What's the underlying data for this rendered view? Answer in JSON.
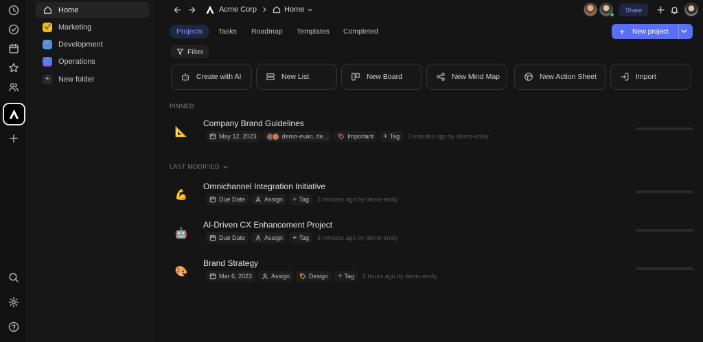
{
  "rail": {
    "icons": [
      "clock-icon",
      "check-circle-icon",
      "calendar-icon",
      "star-icon",
      "users-icon",
      "add-workspace-icon",
      "search-icon",
      "gear-icon",
      "help-icon"
    ]
  },
  "sidebar": {
    "items": [
      {
        "label": "Home"
      },
      {
        "label": "Marketing",
        "badge": "🚀",
        "color": "#f2c200"
      },
      {
        "label": "Development",
        "badge": "👾",
        "color": "#3aa0e8"
      },
      {
        "label": "Operations",
        "badge": "🌐",
        "color": "#7a67f0"
      },
      {
        "label": "New folder"
      }
    ]
  },
  "topbar": {
    "workspace": "Acme Corp",
    "page": "Home",
    "share_label": "Share"
  },
  "tabs": [
    "Projects",
    "Tasks",
    "Roadmap",
    "Templates",
    "Completed"
  ],
  "new_project_label": "New project",
  "filter_label": "Filter",
  "actions": [
    "Create with AI",
    "New List",
    "New Board",
    "New Mind Map",
    "New Action Sheet",
    "Import"
  ],
  "pinned_label": "PINNED",
  "last_modified_label": "LAST MODIFIED",
  "pinned": [
    {
      "emoji": "📐",
      "title": "Company Brand Guidelines",
      "date": "May 12, 2023",
      "assignees": "demo-evan, de...",
      "tag": "Important",
      "add_tag": "Tag",
      "updated": "3 minutes ago by demo-emily"
    }
  ],
  "recent": [
    {
      "emoji": "💪",
      "title": "Omnichannel Integration Initiative",
      "date": "Due Date",
      "assign": "Assign",
      "add_tag": "Tag",
      "updated": "3 minutes ago by demo-emily"
    },
    {
      "emoji": "🤖",
      "title": "AI-Driven CX Enhancement Project",
      "date": "Due Date",
      "assign": "Assign",
      "add_tag": "Tag",
      "updated": "3 minutes ago by demo-emily"
    },
    {
      "emoji": "🎨",
      "title": "Brand Strategy",
      "date": "Mar 6, 2023",
      "assign": "Assign",
      "tag": "Design",
      "add_tag": "Tag",
      "updated": "2 hours ago by demo-emily"
    }
  ],
  "colors": {
    "accent": "#5b6ff5",
    "tag_important": "#e07a6a",
    "tag_design": "#e0b23a"
  }
}
